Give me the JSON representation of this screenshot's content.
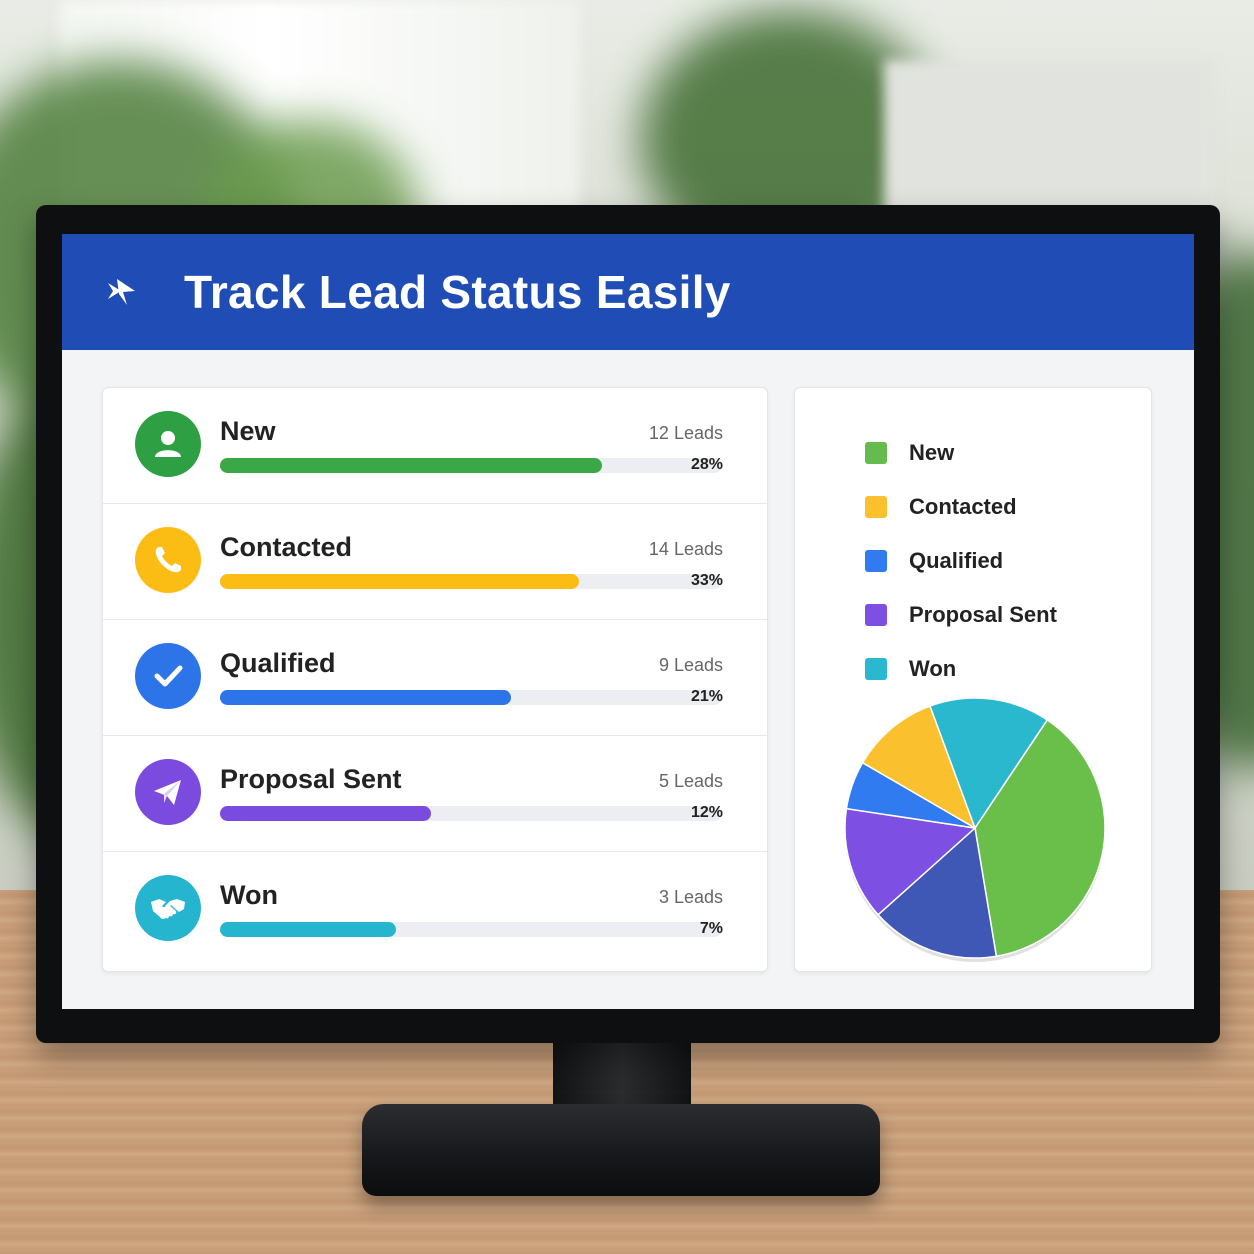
{
  "header": {
    "title": "Track Lead Status Easily",
    "logo_icon": "arrow-bird-icon"
  },
  "statuses": [
    {
      "label": "New",
      "count": "12 Leads",
      "percent_text": "28%",
      "percent": 28,
      "color": "#3aa846",
      "icon": "user-icon"
    },
    {
      "label": "Contacted",
      "count": "14 Leads",
      "percent_text": "33%",
      "percent": 33,
      "color": "#fbbc14",
      "icon": "phone-icon"
    },
    {
      "label": "Qualified",
      "count": "9 Leads",
      "percent_text": "21%",
      "percent": 21,
      "color": "#2c74e8",
      "icon": "check-icon"
    },
    {
      "label": "Proposal Sent",
      "count": "5 Leads",
      "percent_text": "12%",
      "percent": 12,
      "color": "#7b4be0",
      "icon": "paper-plane-icon"
    },
    {
      "label": "Won",
      "count": "3 Leads",
      "percent_text": "7%",
      "percent": 7,
      "color": "#26b5cf",
      "icon": "handshake-icon"
    }
  ],
  "legend": [
    {
      "label": "New",
      "color": "#66bb4f"
    },
    {
      "label": "Contacted",
      "color": "#fbc02d"
    },
    {
      "label": "Qualified",
      "color": "#2f7bef"
    },
    {
      "label": "Proposal Sent",
      "color": "#7d4fe3"
    },
    {
      "label": "Won",
      "color": "#2ab8cf"
    }
  ],
  "chart_data": {
    "type": "pie",
    "slices": [
      {
        "color": "#6abf4b",
        "value": 38
      },
      {
        "color": "#3f57b5",
        "value": 16
      },
      {
        "color": "#7d4fe3",
        "value": 14
      },
      {
        "color": "#2f7bef",
        "value": 6
      },
      {
        "color": "#fbc02d",
        "value": 11
      },
      {
        "color": "#2ab8cf",
        "value": 15
      }
    ]
  }
}
